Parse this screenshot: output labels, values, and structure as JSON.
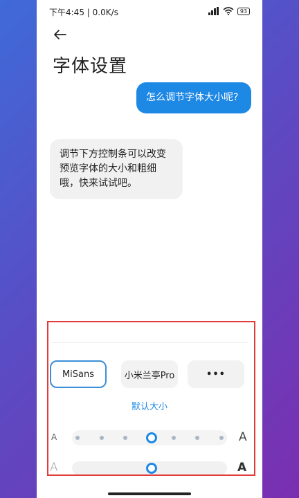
{
  "status": {
    "text": "下午4:45 | 0.0K/s",
    "battery": "93"
  },
  "header": {
    "title": "字体设置"
  },
  "chat": {
    "question": "怎么调节字体大小呢?",
    "answer": "调节下方控制条可以改变预览字体的大小和粗细哦，快来试试吧。"
  },
  "fonts": {
    "items": [
      {
        "label": "MiSans",
        "selected": true
      },
      {
        "label": "小米兰亭Pro",
        "selected": false
      },
      {
        "label": "•••",
        "selected": false
      }
    ]
  },
  "controls": {
    "default_size_label": "默认大小",
    "size_small_label": "A",
    "size_large_label": "A",
    "size_level": 3,
    "size_steps": 7,
    "weight_thin_label": "A",
    "weight_bold_label": "A",
    "weight_level": 0.5
  },
  "colors": {
    "accent": "#1e88e5",
    "highlight": "#e23b3b"
  }
}
